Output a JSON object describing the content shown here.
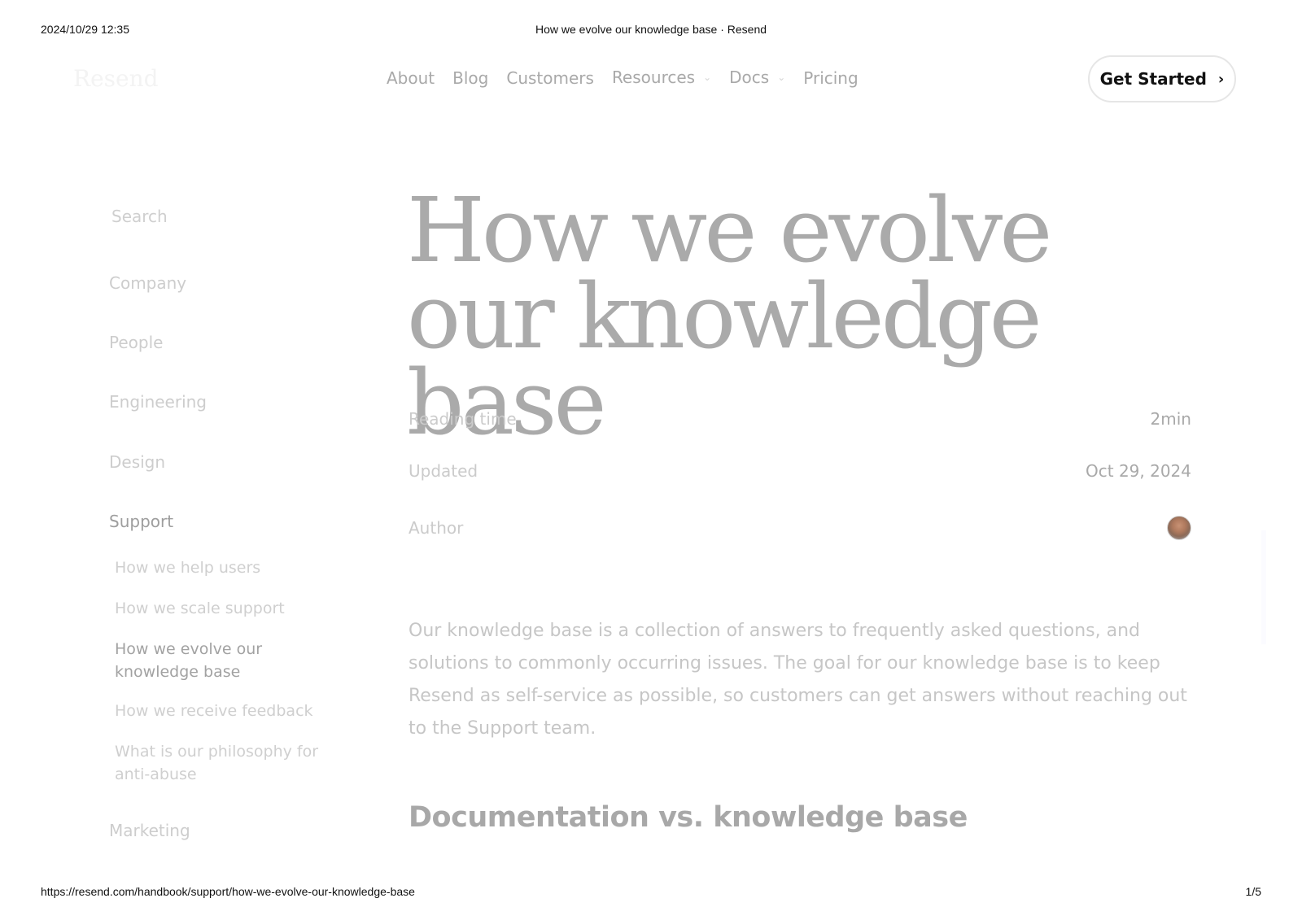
{
  "print": {
    "datetime": "2024/10/29 12:35",
    "doc_title": "How we evolve our knowledge base · Resend",
    "url": "https://resend.com/handbook/support/how-we-evolve-our-knowledge-base",
    "page": "1/5"
  },
  "header": {
    "logo": "Resend",
    "nav": [
      {
        "label": "About"
      },
      {
        "label": "Blog"
      },
      {
        "label": "Customers"
      },
      {
        "label": "Resources",
        "dropdown": true
      },
      {
        "label": "Docs",
        "dropdown": true
      },
      {
        "label": "Pricing"
      }
    ],
    "cta_label": "Get Started"
  },
  "sidebar": {
    "search_label": "Search",
    "sections": [
      {
        "label": "Company"
      },
      {
        "label": "People"
      },
      {
        "label": "Engineering"
      },
      {
        "label": "Design"
      },
      {
        "label": "Support",
        "active": true
      },
      {
        "label": "Marketing"
      }
    ],
    "support_items": [
      {
        "label": "How we help users"
      },
      {
        "label": "How we scale support"
      },
      {
        "label": "How we evolve our knowledge base",
        "active": true
      },
      {
        "label": "How we receive feedback"
      },
      {
        "label": "What is our philosophy for anti-abuse"
      }
    ]
  },
  "article": {
    "title": "How we evolve our knowledge base",
    "meta": {
      "reading_time_label": "Reading time",
      "reading_time_value": "2min",
      "updated_label": "Updated",
      "updated_value": "Oct 29, 2024",
      "author_label": "Author"
    },
    "intro": "Our knowledge base is a collection of answers to frequently asked questions, and solutions to commonly occurring issues. The goal for our knowledge base is to keep Resend as self-service as possible, so customers can get answers without reaching out to the Support team.",
    "section_heading": "Documentation vs. knowledge base"
  }
}
